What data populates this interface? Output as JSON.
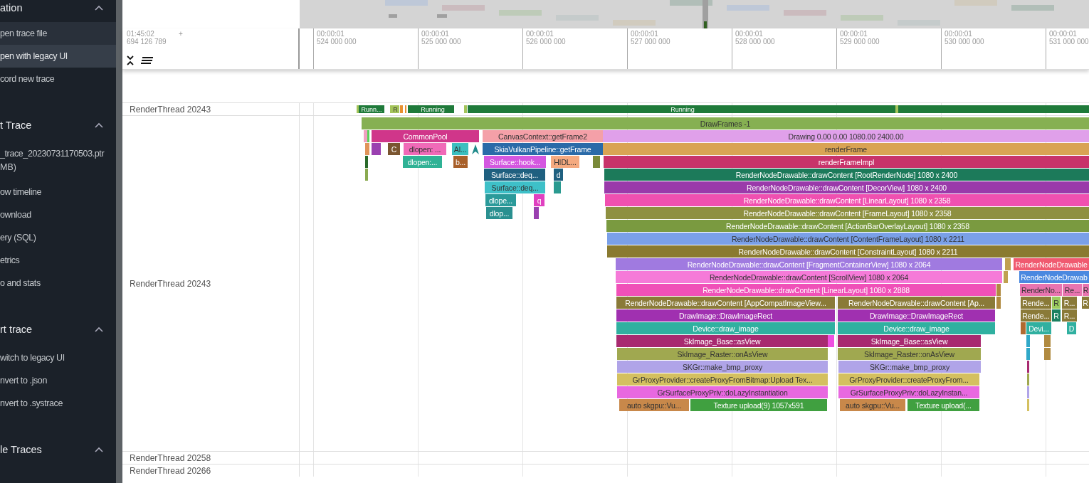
{
  "sidebar": {
    "sections": [
      {
        "title": "ation",
        "items": [
          {
            "label": "pen trace file",
            "selected": false,
            "hovered": true
          },
          {
            "label": "pen with legacy UI",
            "selected": true,
            "hovered": false
          },
          {
            "label": "cord new trace",
            "selected": false,
            "hovered": false
          }
        ]
      },
      {
        "title": "t Trace",
        "items": [
          {
            "label": "_trace_20230731170503.ptr",
            "selected": false,
            "hovered": false,
            "sub": "MB)"
          },
          {
            "label": "ow timeline",
            "selected": false,
            "hovered": false
          },
          {
            "label": "ownload",
            "selected": false,
            "hovered": false
          },
          {
            "label": "ery (SQL)",
            "selected": false,
            "hovered": false
          },
          {
            "label": "etrics",
            "selected": false,
            "hovered": false
          },
          {
            "label": "o and stats",
            "selected": false,
            "hovered": false
          }
        ]
      },
      {
        "title": "rt trace",
        "items": [
          {
            "label": "witch to legacy UI",
            "selected": false,
            "hovered": false
          },
          {
            "label": "nvert to .json",
            "selected": false,
            "hovered": false
          },
          {
            "label": "nvert to .systrace",
            "selected": false,
            "hovered": false
          }
        ]
      },
      {
        "title": "le Traces"
      }
    ]
  },
  "timeline": {
    "offset_time": "01:45:02",
    "offset_ns": "694 126 789",
    "offset_plus": "+",
    "ticks": [
      {
        "time": "00:00:01",
        "ns": "524 000 000"
      },
      {
        "time": "00:00:01",
        "ns": "525 000 000"
      },
      {
        "time": "00:00:01",
        "ns": "526 000 000"
      },
      {
        "time": "00:00:01",
        "ns": "527 000 000"
      },
      {
        "time": "00:00:01",
        "ns": "528 000 000"
      },
      {
        "time": "00:00:01",
        "ns": "529 000 000"
      },
      {
        "time": "00:00:01",
        "ns": "530 000 000"
      },
      {
        "time": "00:00:01",
        "ns": "531 000 000"
      }
    ]
  },
  "tracks": [
    {
      "kind": "state",
      "title": "RenderThread 20243",
      "segments": [
        {
          "color": "#a4c45a"
        },
        {
          "label": "Runn...",
          "color": "#1f7a3a"
        },
        {
          "color": "#a4c45a"
        },
        {
          "label": "R",
          "color": "#a4c45a"
        },
        {
          "color": "#e89030"
        },
        {
          "color": "#e89030"
        },
        {
          "color": "#1f7a3a"
        },
        {
          "label": "Running",
          "color": "#1f7a3a"
        },
        {
          "color": "#a4c45a"
        },
        {
          "color": "#1f7a3a"
        },
        {
          "label": "Running",
          "color": "#1f7a3a"
        },
        {
          "color": "#a4c45a"
        },
        {
          "color": "#1f7a3a"
        }
      ]
    },
    {
      "kind": "slices",
      "title": "RenderThread 20243",
      "levels": [
        {
          "slices": [
            {
              "label": "DrawFrames -1",
              "color": "#86b052"
            }
          ]
        },
        {
          "slices": [
            {
              "color": "#f0a0c0"
            },
            {
              "color": "#5ad05a"
            },
            {
              "label": "CommonPool",
              "color": "#d0368a"
            },
            {
              "label": "CanvasContext::getFrame2",
              "color": "#f4a0a8"
            },
            {
              "label": "Drawing 0.00 0.00 1080.00 2400.00",
              "color": "#e0a0ea"
            }
          ]
        },
        {
          "slices": [
            {
              "color": "#e0945a"
            },
            {
              "color": "#9a40b0"
            },
            {
              "label": "C",
              "color": "#7a5530"
            },
            {
              "label": "dlopen: ...",
              "color": "#f06ab8"
            },
            {
              "label": "Al...",
              "color": "#3bbfbf"
            },
            {
              "label": "SkiaVulkanPipeline::getFrame",
              "color": "#2a6aa8"
            },
            {
              "label": "renderFrame",
              "color": "#d9a354"
            }
          ]
        },
        {
          "slices": [
            {
              "color": "#2a6a2a"
            },
            {
              "label": "dlopen:...",
              "color": "#2fb295"
            },
            {
              "label": "b...",
              "color": "#a8602a"
            },
            {
              "label": "Surface::hook...",
              "color": "#d457e0"
            },
            {
              "label": "HIDL...",
              "color": "#f5aa80"
            },
            {
              "color": "#7a8a3a"
            },
            {
              "label": "renderFrameImpl",
              "color": "#c8336a"
            }
          ]
        },
        {
          "slices": [
            {
              "color": "#8aaa50"
            },
            {
              "label": "Surface::deq...",
              "color": "#1f6080"
            },
            {
              "label": "d",
              "color": "#1f6080"
            },
            {
              "label": "RenderNodeDrawable::drawContent [RootRenderNode] 1080 x 2400",
              "color": "#1c7a5a"
            }
          ]
        },
        {
          "slices": [
            {
              "label": "Surface::deq...",
              "color": "#3ec0c8"
            },
            {
              "color": "#2a9a90"
            },
            {
              "label": "RenderNodeDrawable::drawContent [DecorView] 1080 x 2400",
              "color": "#9a3aaa"
            }
          ]
        },
        {
          "slices": [
            {
              "label": "dlope...",
              "color": "#2a9a9a"
            },
            {
              "label": "q",
              "color": "#e040c0"
            },
            {
              "label": "RenderNodeDrawable::drawContent [LinearLayout] 1080 x 2358",
              "color": "#f050b0"
            }
          ]
        },
        {
          "slices": [
            {
              "label": "dlop...",
              "color": "#2a9090"
            },
            {
              "color": "#9a40b0"
            },
            {
              "label": "RenderNodeDrawable::drawContent [FrameLayout] 1080 x 2358",
              "color": "#8e9040"
            }
          ]
        },
        {
          "slices": [
            {
              "label": "RenderNodeDrawable::drawContent [ActionBarOverlayLayout] 1080 x 2358",
              "color": "#7a9a40"
            }
          ]
        },
        {
          "slices": [
            {
              "label": "RenderNodeDrawable::drawContent [ContentFrameLayout] 1080 x 2211",
              "color": "#7aa0e8"
            }
          ]
        },
        {
          "slices": [
            {
              "label": "RenderNodeDrawable::drawContent [ConstraintLayout] 1080 x 2211",
              "color": "#8a7a30"
            }
          ]
        },
        {
          "slices": [
            {
              "label": "RenderNodeDrawable::drawContent [FragmentContainerView] 1080 x 2064",
              "color": "#a07ae0"
            },
            {
              "color": "#c0a050"
            },
            {
              "label": "RenderNodeDrawable",
              "color": "#f05a70"
            }
          ]
        },
        {
          "slices": [
            {
              "label": "RenderNodeDrawable::drawContent [ScrollView] 1080 x 2064",
              "color": "#f57ad8"
            },
            {
              "color": "#c0a050"
            },
            {
              "label": "RenderNodeDrawab",
              "color": "#4a88e0"
            }
          ]
        },
        {
          "slices": [
            {
              "label": "RenderNodeDrawable::drawContent [LinearLayout] 1080 x 2888",
              "color": "#f050b8"
            },
            {
              "color": "#b08a40"
            },
            {
              "label": "RenderNo...",
              "color": "#e874b0"
            },
            {
              "label": "Re...",
              "color": "#e874b0"
            },
            {
              "label": "R",
              "color": "#e874b0"
            }
          ]
        },
        {
          "slices": [
            {
              "label": "RenderNodeDrawable::drawContent [AppCompatImageView...",
              "color": "#8a7a38"
            },
            {
              "label": "RenderNodeDrawable::drawContent [Ap...",
              "color": "#8a7a38"
            },
            {
              "color": "#b08a40"
            },
            {
              "label": "Rende...",
              "color": "#8a7a38"
            },
            {
              "label": "R",
              "color": "#9ccc60"
            },
            {
              "label": "R...",
              "color": "#8a7a38"
            },
            {
              "label": "R",
              "color": "#8a7a38"
            }
          ]
        },
        {
          "slices": [
            {
              "label": "DrawImage::DrawImageRect",
              "color": "#a030b0"
            },
            {
              "label": "DrawImage::DrawImageRect",
              "color": "#a030b0"
            },
            {
              "label": "Rende...",
              "color": "#8a7a38"
            },
            {
              "label": "R",
              "color": "#1a8060"
            },
            {
              "label": "R...",
              "color": "#8a7a38"
            }
          ]
        },
        {
          "slices": [
            {
              "label": "Device::draw_image",
              "color": "#30b0a0"
            },
            {
              "label": "Device::draw_image",
              "color": "#30b0a0"
            },
            {
              "color": "#b06a30"
            },
            {
              "label": "Devi...",
              "color": "#30b0a0"
            },
            {
              "label": "D",
              "color": "#30b0a0"
            }
          ]
        },
        {
          "slices": [
            {
              "label": "SkImage_Base::asView",
              "color": "#a82a70"
            },
            {
              "color": "#ee50e0"
            },
            {
              "label": "SkImage_Base::asView",
              "color": "#a82a70"
            },
            {
              "color": "#30a8c8"
            },
            {
              "color": "#b08a40"
            }
          ]
        },
        {
          "slices": [
            {
              "label": "SkImage_Raster::onAsView",
              "color": "#a0a850"
            },
            {
              "label": "SkImage_Raster::onAsView",
              "color": "#a0a850"
            },
            {
              "color": "#30a8c8"
            },
            {
              "color": "#b08a40"
            }
          ]
        },
        {
          "slices": [
            {
              "label": "SKGr::make_bmp_proxy",
              "color": "#b0a4e8"
            },
            {
              "label": "SKGr::make_bmp_proxy",
              "color": "#b0a4e8"
            },
            {
              "color": "#a82a70"
            }
          ]
        },
        {
          "slices": [
            {
              "label": "GrProxyProvider::createProxyFromBitmap:Upload Tex...",
              "color": "#d4c060"
            },
            {
              "label": "GrProxyProvider::createProxyFrom...",
              "color": "#d4c060"
            },
            {
              "color": "#a0a850"
            }
          ]
        },
        {
          "slices": [
            {
              "label": "GrSurfaceProxyPriv::doLazyInstantiation",
              "color": "#e868e0"
            },
            {
              "label": "GrSurfaceProxyPriv::doLazyInstan...",
              "color": "#e868e0"
            },
            {
              "color": "#b0a4e8"
            }
          ]
        },
        {
          "slices": [
            {
              "label": "auto skgpu::Vu...",
              "color": "#c8884a"
            },
            {
              "label": "Texture upload(9) 1057x591",
              "color": "#40a040"
            },
            {
              "label": "auto skgpu::Vu...",
              "color": "#c8884a"
            },
            {
              "label": "Texture upload(...",
              "color": "#40a040"
            },
            {
              "color": "#d4c060"
            }
          ]
        }
      ]
    },
    {
      "kind": "empty",
      "title": "RenderThread 20258"
    },
    {
      "kind": "empty",
      "title": "RenderThread 20266"
    }
  ]
}
